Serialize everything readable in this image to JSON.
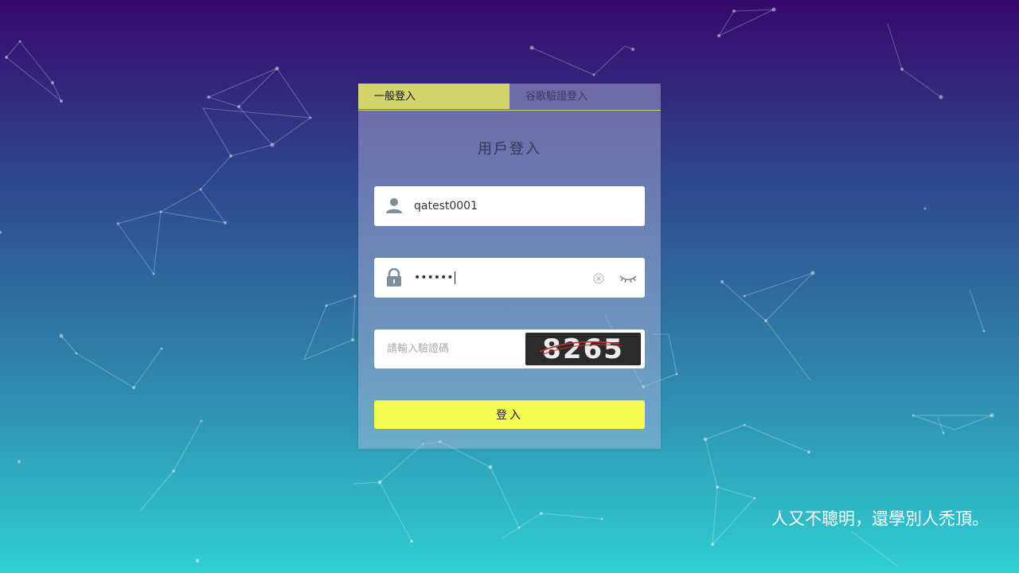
{
  "tabs": [
    {
      "label": "一般登入"
    },
    {
      "label": "谷歌驗證登入"
    }
  ],
  "card": {
    "title": "用戶登入"
  },
  "username": {
    "value": "qatest0001"
  },
  "password": {
    "value": "••••••"
  },
  "captcha": {
    "placeholder": "請輸入驗證碼",
    "code": "8265"
  },
  "submit": {
    "label": "登入"
  },
  "slogan": "人又不聰明，還學別人禿頂。",
  "colors": {
    "tab_active": "#d3d56c",
    "submit_button": "#f4fb53",
    "gradient_top": "#36096c",
    "gradient_bottom": "#2fcfd2"
  },
  "icons": [
    "user-icon",
    "lock-icon",
    "clear-icon",
    "eye-closed-icon"
  ]
}
